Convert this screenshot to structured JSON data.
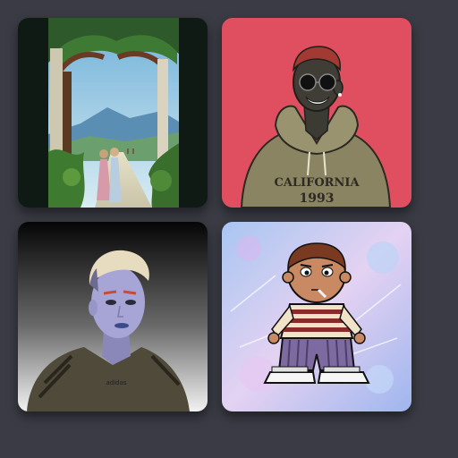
{
  "gallery": {
    "items": [
      {
        "subject": "jungle-arch-painting",
        "background": "#0f1a14"
      },
      {
        "subject": "hoodie-character",
        "background": "#e04f60",
        "hoodie_line1": "CALIFORNIA",
        "hoodie_line2": "1993"
      },
      {
        "subject": "3d-punk-character",
        "background": "#2b2b2b",
        "shirt_logo": "adidas"
      },
      {
        "subject": "cartoon-boy",
        "background": "#b8c7f0"
      }
    ]
  }
}
